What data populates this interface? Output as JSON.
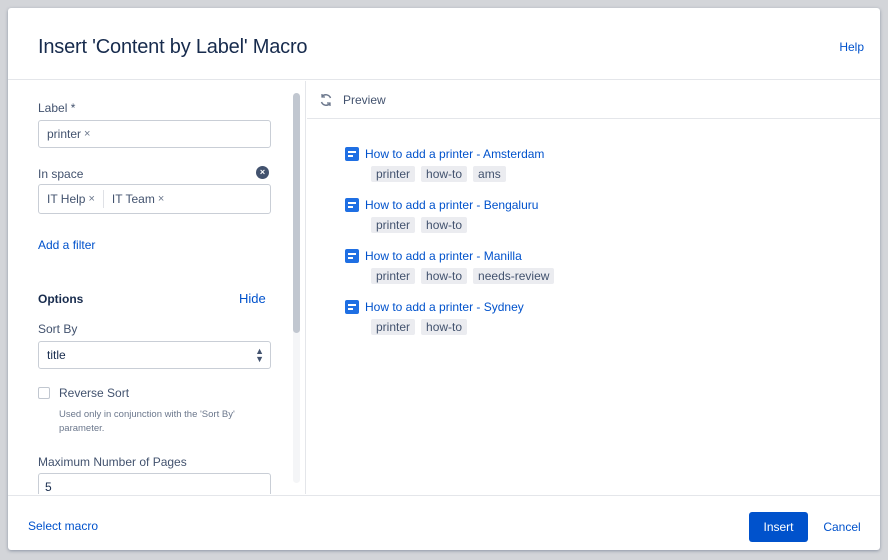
{
  "dialog": {
    "title": "Insert 'Content by Label' Macro",
    "help_label": "Help"
  },
  "form": {
    "label_field": {
      "label": "Label *",
      "chips": [
        "printer"
      ]
    },
    "space_field": {
      "label": "In space",
      "chips": [
        "IT Help",
        "IT Team"
      ]
    },
    "add_filter_label": "Add a filter",
    "options": {
      "heading": "Options",
      "hide_label": "Hide",
      "sort_by": {
        "label": "Sort By",
        "value": "title"
      },
      "reverse_sort": {
        "label": "Reverse Sort",
        "checked": false,
        "hint": "Used only in conjunction with the 'Sort By' parameter."
      },
      "max_pages": {
        "label": "Maximum Number of Pages",
        "value": "5"
      }
    }
  },
  "preview": {
    "label": "Preview",
    "results": [
      {
        "title": "How to add a printer - Amsterdam",
        "tags": [
          "printer",
          "how-to",
          "ams"
        ]
      },
      {
        "title": "How to add a printer - Bengaluru",
        "tags": [
          "printer",
          "how-to"
        ]
      },
      {
        "title": "How to add a printer - Manilla",
        "tags": [
          "printer",
          "how-to",
          "needs-review"
        ]
      },
      {
        "title": "How to add a printer - Sydney",
        "tags": [
          "printer",
          "how-to"
        ]
      }
    ]
  },
  "footer": {
    "select_macro_label": "Select macro",
    "insert_label": "Insert",
    "cancel_label": "Cancel"
  },
  "colors": {
    "accent": "#0052cc",
    "page_icon": "#1f6fe3",
    "tag_bg": "#ebecf0"
  }
}
